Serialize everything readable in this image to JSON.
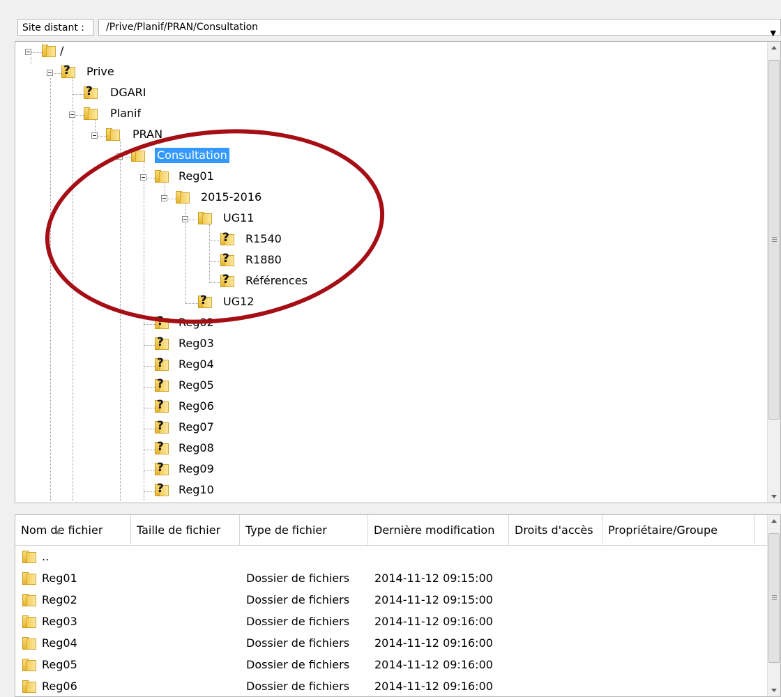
{
  "address": {
    "label": "Site distant :",
    "path": "/Prive/Planif/PRAN/Consultation"
  },
  "tree": {
    "nodes": {
      "root": "/",
      "prive": "Prive",
      "dgari": "DGARI",
      "planif": "Planif",
      "pran": "PRAN",
      "consultation": "Consultation",
      "reg01": "Reg01",
      "y2015": "2015-2016",
      "ug11": "UG11",
      "r1540": "R1540",
      "r1880": "R1880",
      "references": "Références",
      "ug12": "UG12",
      "reg02": "Reg02",
      "reg03": "Reg03",
      "reg04": "Reg04",
      "reg05": "Reg05",
      "reg06": "Reg06",
      "reg07": "Reg07",
      "reg08": "Reg08",
      "reg09": "Reg09",
      "reg10": "Reg10"
    },
    "selected": "Consultation",
    "annotation_color": "#a50e14",
    "selection_color": "#3399ff"
  },
  "filelist": {
    "columns": [
      "Nom de fichier",
      "Taille de fichier",
      "Type de fichier",
      "Dernière modification",
      "Droits d'accès",
      "Propriétaire/Groupe"
    ],
    "rows": [
      {
        "name": "..",
        "size": "",
        "type": "",
        "modified": ""
      },
      {
        "name": "Reg01",
        "size": "",
        "type": "Dossier de fichiers",
        "modified": "2014-11-12 09:15:00"
      },
      {
        "name": "Reg02",
        "size": "",
        "type": "Dossier de fichiers",
        "modified": "2014-11-12 09:15:00"
      },
      {
        "name": "Reg03",
        "size": "",
        "type": "Dossier de fichiers",
        "modified": "2014-11-12 09:16:00"
      },
      {
        "name": "Reg04",
        "size": "",
        "type": "Dossier de fichiers",
        "modified": "2014-11-12 09:16:00"
      },
      {
        "name": "Reg05",
        "size": "",
        "type": "Dossier de fichiers",
        "modified": "2014-11-12 09:16:00"
      },
      {
        "name": "Reg06",
        "size": "",
        "type": "Dossier de fichiers",
        "modified": "2014-11-12 09:16:00"
      }
    ]
  }
}
